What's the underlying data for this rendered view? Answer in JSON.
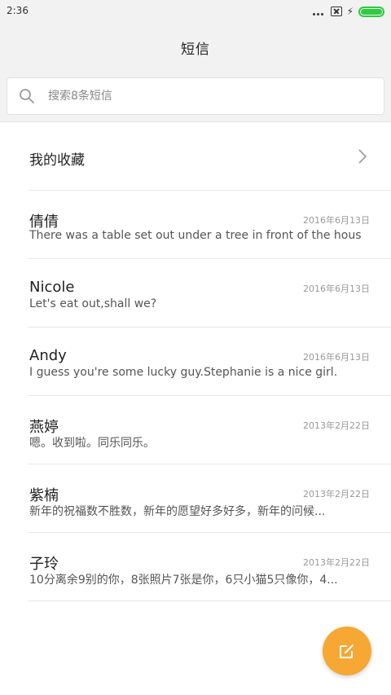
{
  "status_bar": {
    "time": "2:36",
    "icons": [
      "signal-dots-icon",
      "sim-absent-icon",
      "charging-icon",
      "battery-icon"
    ]
  },
  "header": {
    "title": "短信"
  },
  "search": {
    "placeholder": "搜索8条短信",
    "icon": "search-icon"
  },
  "favorites": {
    "label": "我的收藏",
    "icon": "chevron-right-icon"
  },
  "messages": [
    {
      "name": "倩倩",
      "date": "2016年6月13日",
      "preview": "There was a table set out under a tree in front of the hous"
    },
    {
      "name": "Nicole",
      "date": "2016年6月13日",
      "preview": "Let's eat out,shall we?"
    },
    {
      "name": "Andy",
      "date": "2016年6月13日",
      "preview": "I guess you're some lucky guy.Stephanie is a nice girl."
    },
    {
      "name": "燕婷",
      "date": "2013年2月22日",
      "preview": "嗯。收到啦。同乐同乐。"
    },
    {
      "name": "紫楠",
      "date": "2013年2月22日",
      "preview": "新年的祝福数不胜数，新年的愿望好多好多，新年的问候..."
    },
    {
      "name": "子玲",
      "date": "2013年2月22日",
      "preview": "10分离余9别的你，8张照片7张是你，6只小猫5只像你，4..."
    }
  ],
  "fab": {
    "icon": "compose-icon"
  },
  "colors": {
    "accent": "#f7a733",
    "battery": "#2ecc40",
    "header_bg": "#f2f2f2"
  }
}
